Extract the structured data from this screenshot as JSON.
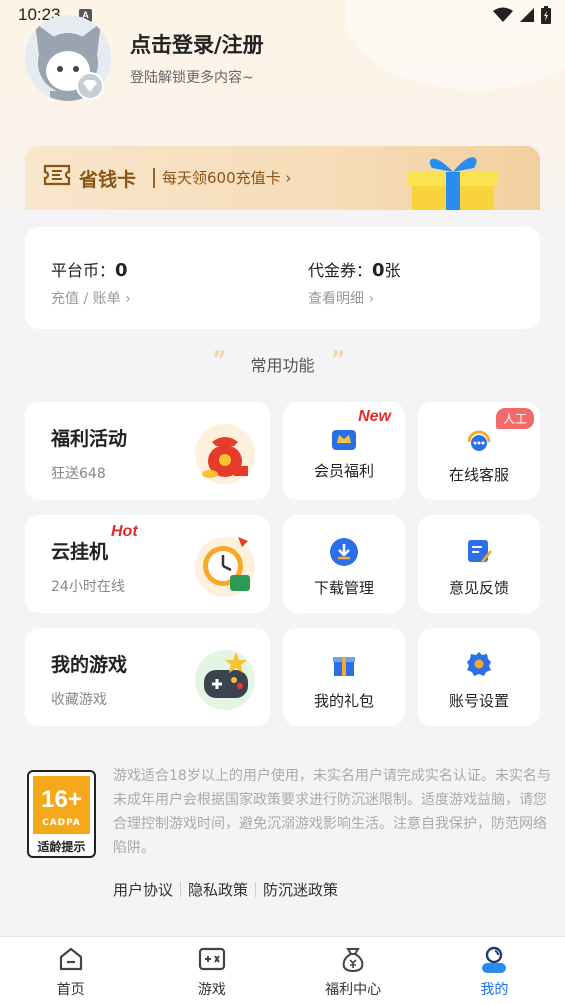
{
  "status_bar": {
    "time": "10:23",
    "notif": "A"
  },
  "profile": {
    "title": "点击登录/注册",
    "subtitle": "登陆解锁更多内容~"
  },
  "save_card": {
    "title": "省钱卡",
    "link": "每天领600充值卡"
  },
  "balance": {
    "coin_label": "平台币：",
    "coin_value": "0",
    "coin_link": "充值 / 账单",
    "voucher_label": "代金券：",
    "voucher_value": "0",
    "voucher_unit": "张",
    "voucher_link": "查看明细"
  },
  "section": {
    "title": "常用功能",
    "quote_left": "”",
    "quote_right": "”"
  },
  "features": {
    "welfare": {
      "title": "福利活动",
      "sub": "狂送648"
    },
    "cloud": {
      "title": "云挂机",
      "tag": "Hot",
      "sub": "24小时在线"
    },
    "mygames": {
      "title": "我的游戏",
      "sub": "收藏游戏"
    },
    "vip": {
      "label": "会员福利",
      "tag": "New"
    },
    "service": {
      "label": "在线客服",
      "tag": "人工"
    },
    "download": {
      "label": "下载管理"
    },
    "feedback": {
      "label": "意见反馈"
    },
    "gifts": {
      "label": "我的礼包"
    },
    "settings": {
      "label": "账号设置"
    }
  },
  "age_rating": {
    "number": "16+",
    "org": "CADPA",
    "caption": "适龄提示"
  },
  "notice": "游戏适合18岁以上的用户使用，未实名用户请完成实名认证。未实名与未成年用户会根据国家政策要求进行防沉迷限制。适度游戏益脑，请您合理控制游戏时间，避免沉溺游戏影响生活。注意自我保护，防范网络陷阱。",
  "links": [
    "用户协议",
    "隐私政策",
    "防沉迷政策"
  ],
  "tabs": [
    {
      "label": "首页"
    },
    {
      "label": "游戏"
    },
    {
      "label": "福利中心"
    },
    {
      "label": "我的"
    }
  ],
  "colors": {
    "accent": "#1a6fe8",
    "gold": "#8a5514",
    "hot": "#e22b2b"
  }
}
